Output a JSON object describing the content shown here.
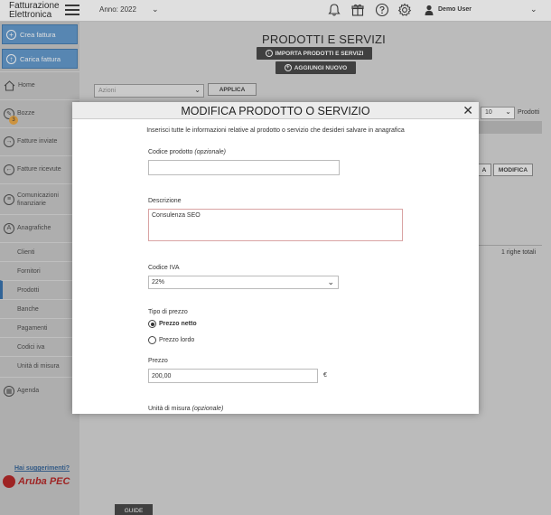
{
  "topbar": {
    "brand_line1": "Fatturazione",
    "brand_line2": "Elettronica",
    "year": "Anno: 2022",
    "user": "Demo User"
  },
  "sidebar": {
    "create_invoice": "Crea fattura",
    "upload_invoice": "Carica fattura",
    "items": [
      {
        "label": "Home",
        "icon": "home-icon"
      },
      {
        "label": "Bozze",
        "icon": "drafts-icon",
        "badge": "3"
      },
      {
        "label": "Fatture inviate",
        "icon": "sent-icon"
      },
      {
        "label": "Fatture ricevute",
        "icon": "received-icon"
      },
      {
        "label": "Comunicazioni finanziarie",
        "icon": "communications-icon"
      },
      {
        "label": "Anagrafiche",
        "icon": "registry-icon"
      }
    ],
    "subitems": [
      "Clienti",
      "Fornitori",
      "Prodotti",
      "Banche",
      "Pagamenti",
      "Codici iva",
      "Unità di misura"
    ],
    "agenda": "Agenda",
    "suggestions": "Hai suggerimenti?",
    "logo_text": "Aruba PEC"
  },
  "main": {
    "title": "PRODOTTI E SERVIZI",
    "import_button": "IMPORTA PRODOTTI E SERVIZI",
    "add_button": "AGGIUNGI NUOVO",
    "actions_placeholder": "Azioni",
    "apply_button": "APPLICA",
    "per_page_value": "10",
    "per_page_label": "Prodotti",
    "row_button_partial": "A",
    "edit_button": "MODIFICA",
    "rows_total": "1 righe totali",
    "guide_button": "GUIDE"
  },
  "modal": {
    "title": "MODIFICA PRODOTTO O SERVIZIO",
    "intro": "Inserisci tutte le informazioni relative al prodotto o servizio che desideri salvare in anagrafica",
    "product_code_label": "Codice prodotto",
    "optional": "(opzionale)",
    "product_code_value": "",
    "description_label": "Descrizione",
    "description_value": "Consulenza SEO",
    "vat_label": "Codice IVA",
    "vat_value": "22%",
    "price_type_label": "Tipo di prezzo",
    "price_net": "Prezzo netto",
    "price_gross": "Prezzo lordo",
    "price_type_selected": "net",
    "price_label": "Prezzo",
    "price_value": "200,00",
    "currency": "€",
    "unit_label": "Unità di misura"
  },
  "colors": {
    "primary_button": "#5a93c8",
    "dark_button": "#3d3d3d",
    "brand_red": "#b01c1c"
  }
}
